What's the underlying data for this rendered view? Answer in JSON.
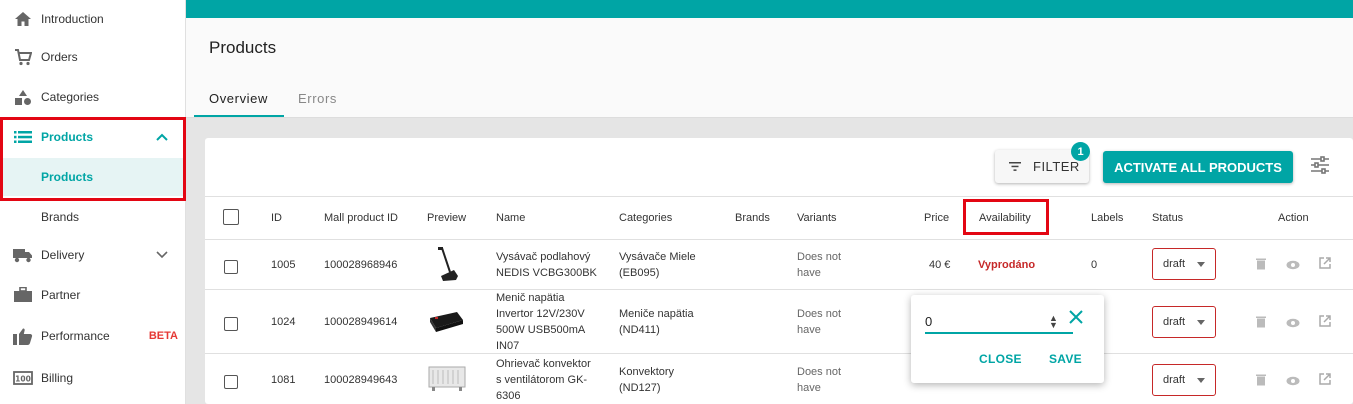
{
  "sidebar": {
    "items": [
      {
        "label": "Introduction",
        "icon": "home-icon"
      },
      {
        "label": "Orders",
        "icon": "cart-icon"
      },
      {
        "label": "Categories",
        "icon": "shapes-icon"
      },
      {
        "label": "Products",
        "icon": "list-icon"
      },
      {
        "label": "Delivery",
        "icon": "truck-icon"
      },
      {
        "label": "Partner",
        "icon": "briefcase-icon"
      },
      {
        "label": "Performance",
        "icon": "thumb-up-icon",
        "badge": "BETA"
      },
      {
        "label": "Billing",
        "icon": "billing-icon"
      }
    ],
    "sub_items": [
      "Products",
      "Brands"
    ]
  },
  "header": {
    "title": "Products",
    "tabs": [
      "Overview",
      "Errors"
    ]
  },
  "toolbar": {
    "filter_label": "FILTER",
    "filter_count": "1",
    "activate_label": "ACTIVATE ALL PRODUCTS"
  },
  "table": {
    "columns": [
      "ID",
      "Mall product ID",
      "Preview",
      "Name",
      "Categories",
      "Brands",
      "Variants",
      "Price",
      "Availability",
      "Labels",
      "Status",
      "Action"
    ],
    "rows": [
      {
        "id": "1005",
        "mall_id": "100028968946",
        "name": "Vysávač podlahový NEDIS VCBG300BK",
        "name_lines": [
          "Vysávač podlahový",
          "NEDIS VCBG300BK"
        ],
        "category_lines": [
          "Vysávače Miele",
          "(EB095)"
        ],
        "variants_lines": [
          "Does not",
          "have"
        ],
        "price": "40 €",
        "availability": "Vyprodáno",
        "labels": "0",
        "status": "draft"
      },
      {
        "id": "1024",
        "mall_id": "100028949614",
        "name_lines": [
          "Menič napätia",
          "Invertor 12V/230V",
          "500W USB500mA",
          "IN07"
        ],
        "category_lines": [
          "Meniče napätia",
          "(ND411)"
        ],
        "variants_lines": [
          "Does not",
          "have"
        ],
        "status": "draft"
      },
      {
        "id": "1081",
        "mall_id": "100028949643",
        "name_lines": [
          "Ohrievač konvektor",
          "s ventilátorom GK-",
          "6306"
        ],
        "category_lines": [
          "Konvektory",
          "(ND127)"
        ],
        "variants_lines": [
          "Does not",
          "have"
        ],
        "status": "draft"
      }
    ]
  },
  "popup": {
    "value": "0",
    "close_label": "CLOSE",
    "save_label": "SAVE"
  },
  "colors": {
    "accent": "#00a5a5",
    "highlight": "#e30613",
    "error": "#c62828"
  }
}
